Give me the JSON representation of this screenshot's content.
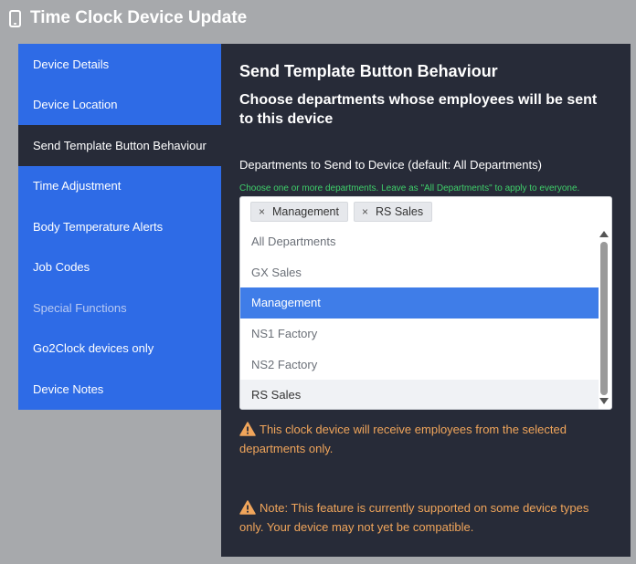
{
  "header": {
    "title": "Time Clock Device Update",
    "icon": "mobile-phone-icon"
  },
  "sidebar": {
    "items": [
      {
        "label": "Device Details"
      },
      {
        "label": "Device Location"
      },
      {
        "label": "Send Template Button Behaviour"
      },
      {
        "label": "Time Adjustment"
      },
      {
        "label": "Body Temperature Alerts"
      },
      {
        "label": "Job Codes"
      },
      {
        "label": "Special Functions"
      },
      {
        "label": "Go2Clock devices only"
      },
      {
        "label": "Device Notes"
      }
    ],
    "active_index": 2,
    "disabled_index": 6
  },
  "panel": {
    "heading": "Send Template Button Behaviour",
    "subheading": "Choose departments whose employees will be sent to this device",
    "field_label": "Departments to Send to Device (default: All Departments)",
    "hint": "Choose one or more departments. Leave as \"All Departments\" to apply to everyone.",
    "selected_chips": [
      {
        "label": "Management"
      },
      {
        "label": "RS Sales"
      }
    ],
    "chip_remove_glyph": "×",
    "options": [
      {
        "label": "All Departments"
      },
      {
        "label": "GX Sales"
      },
      {
        "label": "Management"
      },
      {
        "label": "NS1 Factory"
      },
      {
        "label": "NS2 Factory"
      },
      {
        "label": "RS Sales"
      }
    ],
    "warning1": "This clock device will receive employees from the selected departments only.",
    "warning2": "Note: This feature is currently supported on some device types only. Your device may not yet be compatible."
  },
  "colors": {
    "sidebar_bg": "#2e6be6",
    "active_bg": "#272b38",
    "hint": "#3fcf6a",
    "warning": "#f0a55b",
    "selected_option": "#3f7de8"
  }
}
